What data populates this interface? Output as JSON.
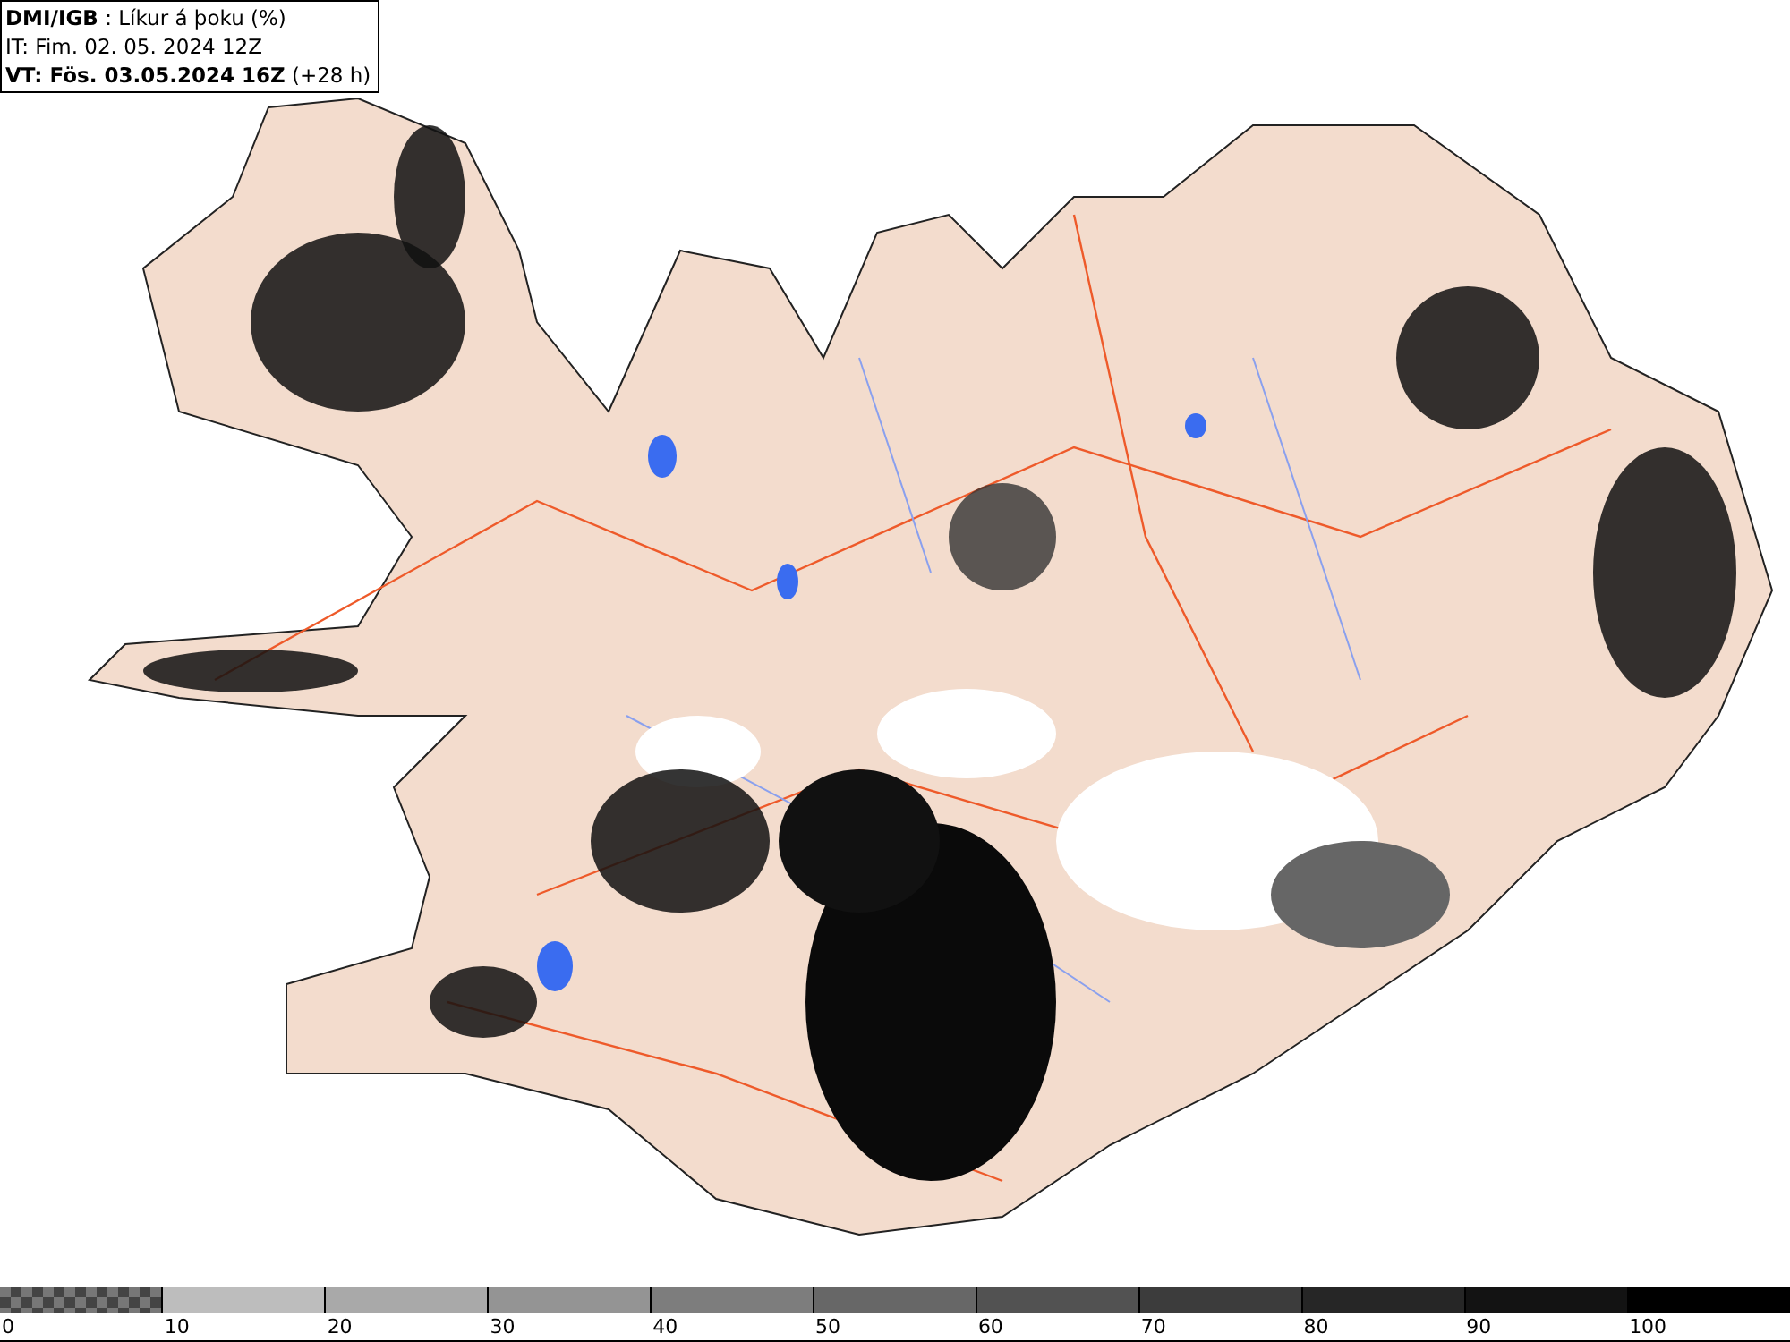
{
  "header": {
    "lines": [
      "**DMI/IGB** : Líkur á þoku (%)",
      "IT: Fim. 02. 05. 2024 12Z",
      "**VT: Fös. 03.05.2024 16Z** (+28 h)"
    ]
  },
  "legend": {
    "swatches": [
      {
        "kind": "checker",
        "color": "#777777"
      },
      {
        "kind": "solid",
        "color": "#bdbdbd"
      },
      {
        "kind": "solid",
        "color": "#a9a9a9"
      },
      {
        "kind": "solid",
        "color": "#949494"
      },
      {
        "kind": "solid",
        "color": "#7d7d7d"
      },
      {
        "kind": "solid",
        "color": "#676767"
      },
      {
        "kind": "solid",
        "color": "#525252"
      },
      {
        "kind": "solid",
        "color": "#3c3c3c"
      },
      {
        "kind": "solid",
        "color": "#262626"
      },
      {
        "kind": "solid",
        "color": "#131313"
      },
      {
        "kind": "solid",
        "color": "#000000"
      }
    ],
    "labels": [
      "0",
      "10",
      "20",
      "30",
      "40",
      "50",
      "60",
      "70",
      "80",
      "90",
      "100"
    ]
  }
}
